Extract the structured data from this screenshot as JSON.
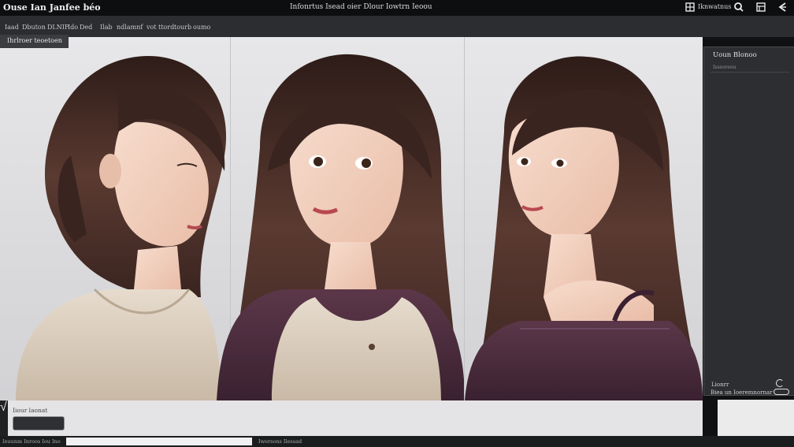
{
  "window": {
    "app_title": "Ouse Ian Janfee béo",
    "title": "Infonrtus Isead oier Dlour Iowtrn Ieoouter",
    "tb_label": "Iknwatnus"
  },
  "menu": {
    "items": [
      "Iaad",
      "Dbuton",
      "DLNIF",
      "Ido",
      "Ded",
      "Ilab",
      "ndlamnf",
      "vot",
      "ttord",
      "tourb",
      "oumo"
    ]
  },
  "tab": {
    "active_label": "Ihrlroer teoetoen"
  },
  "right_panel": {
    "title": "Uoun Blonoo",
    "subtitle": "Isseoreeu",
    "item_label": "Lionrr",
    "footer_text": "Biea un Ioeremnornar"
  },
  "bottom": {
    "field_label": "Iiour laonat",
    "checkbox_glyph": "√",
    "status_left": "Ieuunm Inroos Iou Ino",
    "status_right": "Iwersons Ilessad"
  },
  "gallery": {
    "images": [
      {
        "name": "portrait-1",
        "subject": "woman with chestnut hair in beige knit sweater, profile view"
      },
      {
        "name": "portrait-2",
        "subject": "woman with long brown hair in beige top and purple cardigan"
      },
      {
        "name": "portrait-3",
        "subject": "woman with long brown hair in purple off-shoulder sweater"
      }
    ]
  },
  "colors": {
    "chrome_dark": "#0d0e0f",
    "menubar": "#2b2d30",
    "panel": "#2c2e31",
    "canvas_bg": "#e3e3e5",
    "hair": "#4a2f29",
    "skin": "#f0cbb9",
    "sweater_beige": "#dccfc0",
    "sweater_purple": "#4d2e3f"
  }
}
